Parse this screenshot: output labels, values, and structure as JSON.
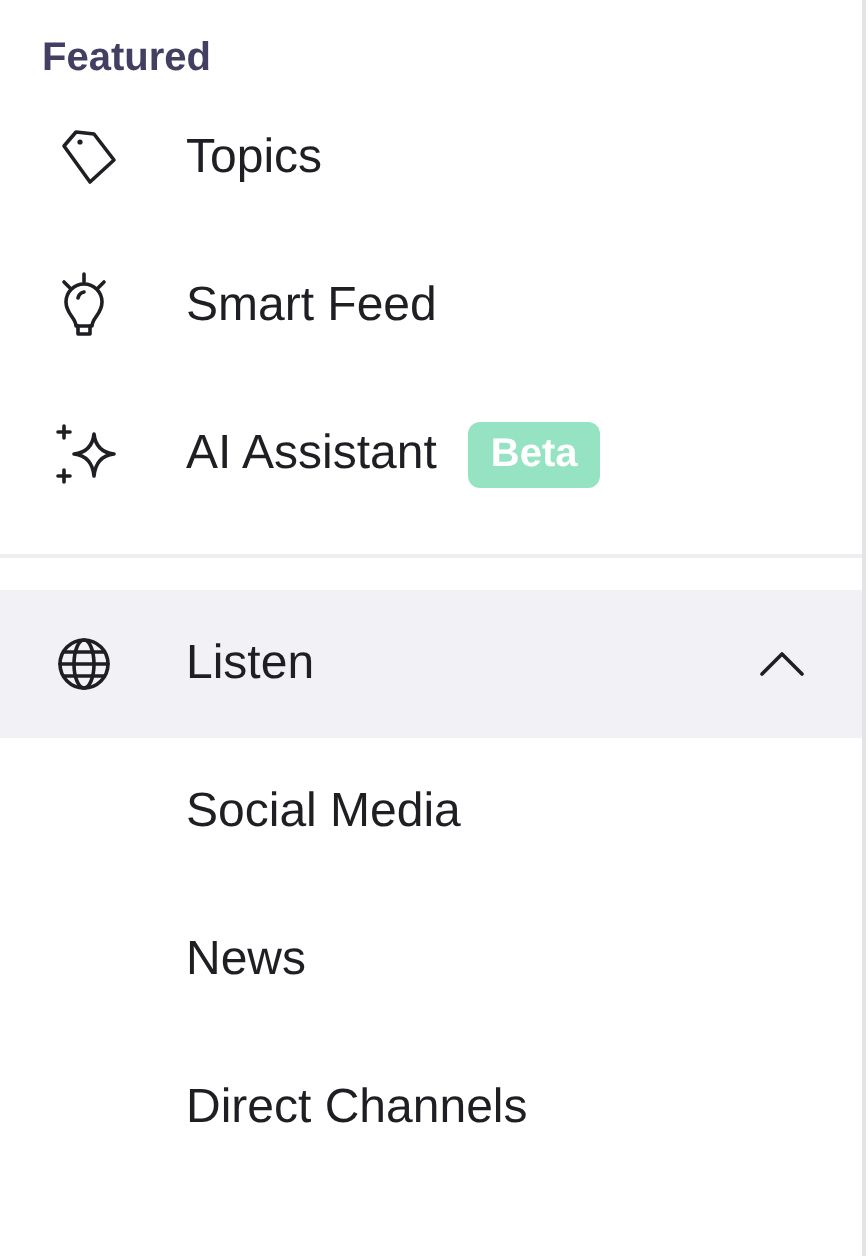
{
  "sidebar": {
    "section_title": "Featured",
    "items": [
      {
        "label": "Topics",
        "selected": false
      },
      {
        "label": "Smart Feed",
        "selected": false
      },
      {
        "label": "AI Assistant",
        "badge": "Beta",
        "selected": false
      }
    ],
    "groups": [
      {
        "label": "Listen",
        "expanded": true,
        "selected": true,
        "children": [
          {
            "label": "Social Media",
            "selected": false
          },
          {
            "label": "News",
            "selected": false
          },
          {
            "label": "Direct Channels",
            "selected": false
          }
        ]
      }
    ]
  }
}
